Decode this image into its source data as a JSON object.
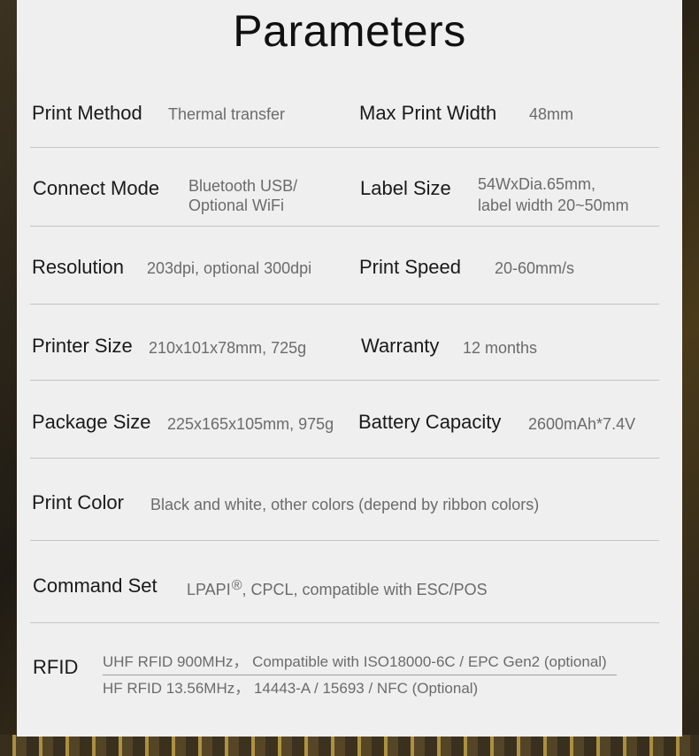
{
  "title": "Parameters",
  "specs": {
    "print_method": {
      "label": "Print Method",
      "value": "Thermal transfer"
    },
    "max_print_width": {
      "label": "Max Print Width",
      "value": "48mm"
    },
    "connect_mode": {
      "label": "Connect Mode",
      "value_line1": "Bluetooth USB/",
      "value_line2": "Optional WiFi"
    },
    "label_size": {
      "label": "Label Size",
      "value_line1": "54WxDia.65mm,",
      "value_line2": "label width 20~50mm"
    },
    "resolution": {
      "label": "Resolution",
      "value": "203dpi, optional 300dpi"
    },
    "print_speed": {
      "label": "Print Speed",
      "value": "20-60mm/s"
    },
    "printer_size": {
      "label": "Printer Size",
      "value": "210x101x78mm, 725g"
    },
    "warranty": {
      "label": "Warranty",
      "value": "12 months"
    },
    "package_size": {
      "label": "Package Size",
      "value": "225x165x105mm, 975g"
    },
    "battery_capacity": {
      "label": "Battery Capacity",
      "value": "2600mAh*7.4V"
    },
    "print_color": {
      "label": "Print Color",
      "value": "Black and white, other colors (depend by ribbon colors)"
    },
    "command_set": {
      "label": "Command Set",
      "value_main": "LPAPI",
      "value_mark": "®",
      "value_rest": ", CPCL, compatible with ESC/POS"
    },
    "rfid": {
      "label": "RFID",
      "value_line1": "UHF RFID 900MHz， Compatible with ISO18000-6C / EPC Gen2 (optional)",
      "value_line2": "HF RFID 13.56MHz， 14443-A / 15693 / NFC (Optional)"
    }
  }
}
